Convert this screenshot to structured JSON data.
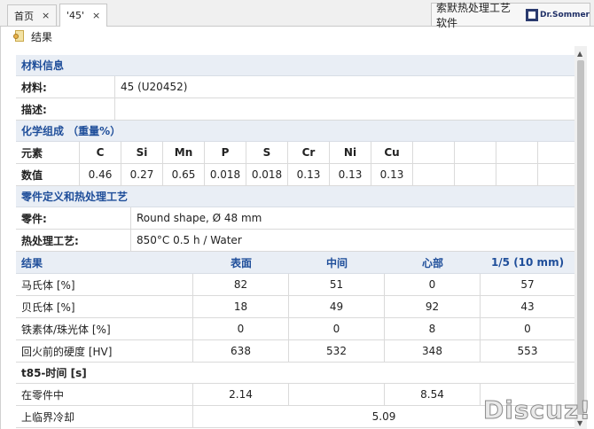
{
  "tabs": [
    {
      "label": "首页",
      "close": "×"
    },
    {
      "label": "'45'",
      "close": "×"
    }
  ],
  "brand": {
    "text": "索默热处理工艺软件",
    "logo": "Dr.Sommer"
  },
  "toolbar": {
    "label": "结果",
    "icon": "result-icon"
  },
  "material": {
    "section": "材料信息",
    "rows": [
      {
        "label": "材料:",
        "value": "45 (U20452)"
      },
      {
        "label": "描述:",
        "value": ""
      }
    ]
  },
  "chemistry": {
    "section": "化学组成 （重量%）",
    "header_label": "元素",
    "value_label": "数值",
    "elements": [
      "C",
      "Si",
      "Mn",
      "P",
      "S",
      "Cr",
      "Ni",
      "Cu"
    ],
    "values": [
      "0.46",
      "0.27",
      "0.65",
      "0.018",
      "0.018",
      "0.13",
      "0.13",
      "0.13"
    ]
  },
  "part": {
    "section": "零件定义和热处理工艺",
    "rows": [
      {
        "label": "零件:",
        "value": "Round shape, Ø 48 mm"
      },
      {
        "label": "热处理工艺:",
        "value": "850°C 0.5 h / Water"
      }
    ]
  },
  "results": {
    "header": [
      "结果",
      "表面",
      "中间",
      "心部",
      "1/5 (10 mm)"
    ],
    "rows": [
      {
        "label": "马氏体 [%]",
        "values": [
          "82",
          "51",
          "0",
          "57"
        ]
      },
      {
        "label": "贝氏体 [%]",
        "values": [
          "18",
          "49",
          "92",
          "43"
        ]
      },
      {
        "label": "铁素体/珠光体 [%]",
        "values": [
          "0",
          "0",
          "8",
          "0"
        ]
      },
      {
        "label": "回火前的硬度 [HV]",
        "values": [
          "638",
          "532",
          "348",
          "553"
        ]
      }
    ]
  },
  "t85": {
    "section": "t85-时间 [s]",
    "rows": [
      {
        "label": "在零件中",
        "values": [
          "2.14",
          "",
          "8.54",
          ""
        ]
      },
      {
        "label": "上临界冷却",
        "value": "5.09"
      }
    ]
  },
  "watermark": "Discuz!"
}
